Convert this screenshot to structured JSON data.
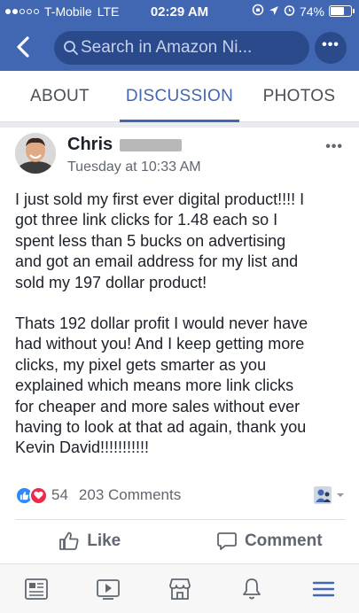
{
  "status_bar": {
    "carrier": "T-Mobile",
    "network": "LTE",
    "time": "02:29 AM",
    "battery": "74%",
    "battery_level": 0.74
  },
  "header": {
    "search_placeholder": "Search in Amazon Ni...",
    "more_label": "•••"
  },
  "tabs": [
    {
      "label": "ABOUT",
      "active": false
    },
    {
      "label": "DISCUSSION",
      "active": true
    },
    {
      "label": "PHOTOS",
      "active": false
    }
  ],
  "post": {
    "author": "Chris",
    "timestamp": "Tuesday at 10:33 AM",
    "more_label": "•••",
    "paragraphs": [
      "I just sold my first ever digital product!!!! I\ngot three link clicks for 1.48 each so I\nspent less than 5 bucks on advertising\nand got an email address for my list and\nsold my 197 dollar product!",
      "Thats 192 dollar profit I would never have\nhad without you! And I keep getting more\nclicks, my pixel gets smarter as you\nexplained which means more link clicks\nfor cheaper and more sales without ever\nhaving to look at that ad again, thank you\nKevin David!!!!!!!!!!!"
    ],
    "reaction_count": "54",
    "comment_count": "203 Comments"
  },
  "actions": {
    "like": "Like",
    "comment": "Comment"
  },
  "colors": {
    "brand": "#4267b2",
    "like": "#2e89ff",
    "love": "#f0284a"
  }
}
